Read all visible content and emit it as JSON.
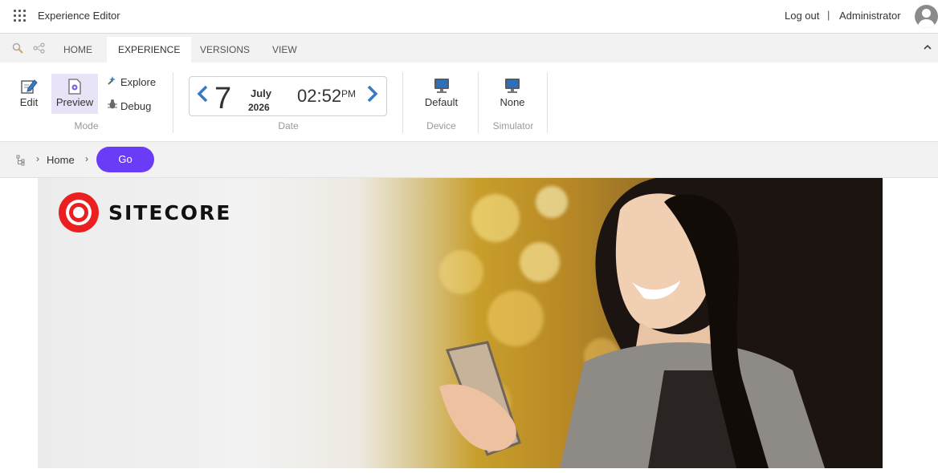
{
  "topbar": {
    "app_title": "Experience Editor",
    "logout": "Log out",
    "separator": "|",
    "user": "Administrator"
  },
  "ribbon": {
    "tabs": [
      {
        "label": "HOME",
        "active": false
      },
      {
        "label": "EXPERIENCE",
        "active": true
      },
      {
        "label": "VERSIONS",
        "active": false
      },
      {
        "label": "VIEW",
        "active": false
      }
    ],
    "mode": {
      "label": "Mode",
      "edit": "Edit",
      "preview": "Preview",
      "explore": "Explore",
      "debug": "Debug"
    },
    "date": {
      "label": "Date",
      "day": "7",
      "month": "July",
      "year": "2026",
      "time": "02:52",
      "ampm": "PM"
    },
    "device": {
      "label": "Device",
      "value": "Default"
    },
    "simulator": {
      "label": "Simulator",
      "value": "None"
    }
  },
  "breadcrumb": {
    "home": "Home",
    "go": "Go"
  },
  "hero": {
    "logo_text": "SITECORE",
    "logo_color": "#eb1f1f"
  },
  "colors": {
    "accent": "#6b3cf7",
    "nav_arrow": "#3a78c4",
    "selected_bg": "#e8e3f7"
  },
  "icons": [
    "apps-grid-icon",
    "search-icon",
    "share-icon",
    "chevron-up-icon",
    "edit-icon",
    "preview-icon",
    "explore-icon",
    "debug-icon",
    "chevron-left-icon",
    "chevron-right-icon",
    "monitor-icon",
    "tree-icon",
    "user-avatar-icon"
  ]
}
